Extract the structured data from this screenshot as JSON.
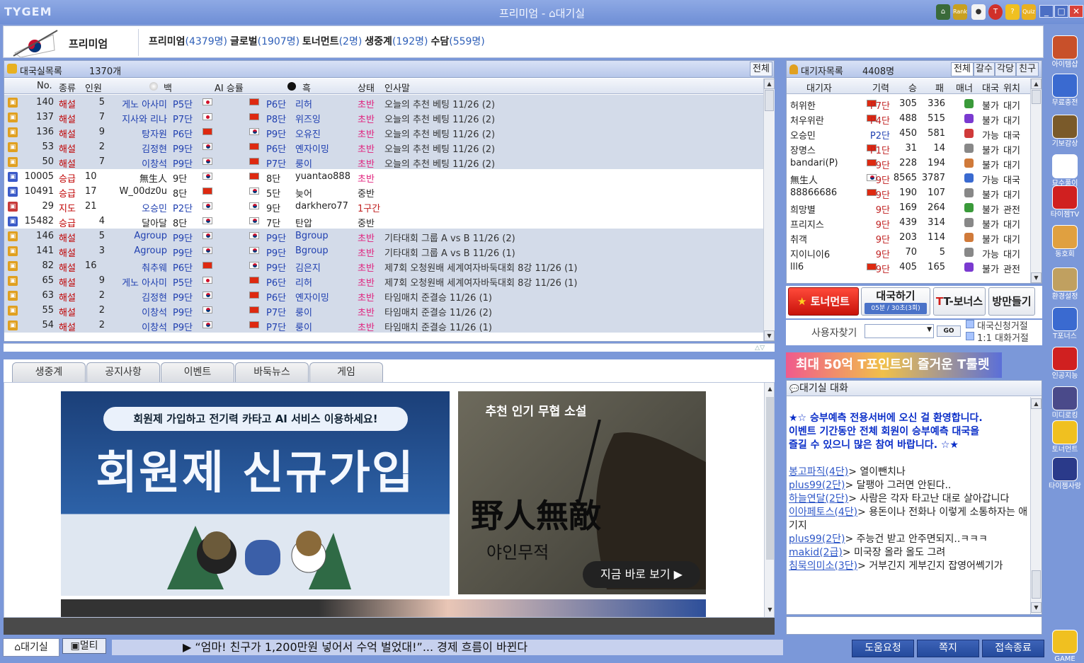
{
  "app": {
    "logo": "TYGEM",
    "title": "프리미엄 - ",
    "title_room": "대기실",
    "title_icons": [
      "Rank",
      "Quiz"
    ]
  },
  "header": {
    "label": "프리미엄",
    "servers": [
      {
        "name": "프리미엄",
        "count": "(4379명)"
      },
      {
        "name": "글로벌",
        "count": "(1907명)"
      },
      {
        "name": "토너먼트",
        "count": "(2명)"
      },
      {
        "name": "생중계",
        "count": "(192명)"
      },
      {
        "name": "수담",
        "count": "(559명)"
      }
    ]
  },
  "gamelist": {
    "title": "대국실목록",
    "count": "1370개",
    "all_button": "전체",
    "columns": [
      "No.",
      "종류",
      "인원",
      "백",
      "AI 승률",
      "흑",
      "상태",
      "인사말"
    ],
    "rows": [
      {
        "type": "B",
        "no": "140",
        "kind": "해설",
        "people": "5",
        "white": "게노 아사미",
        "wrank": "P5단",
        "wflag": "jp",
        "brank": "P6단",
        "black": "리허",
        "bflag": "cn",
        "status": "초반",
        "msg": "오늘의 추천 베팅 11/26 (2)",
        "hl": true
      },
      {
        "type": "B",
        "no": "137",
        "kind": "해설",
        "people": "7",
        "white": "지사와 리나",
        "wrank": "P7단",
        "wflag": "jp",
        "brank": "P8단",
        "black": "위즈잉",
        "bflag": "cn",
        "status": "초반",
        "msg": "오늘의 추천 베팅 11/26 (2)",
        "hl": true
      },
      {
        "type": "B",
        "no": "136",
        "kind": "해설",
        "people": "9",
        "white": "탕자원",
        "wrank": "P6단",
        "wflag": "cn",
        "brank": "P9단",
        "black": "오유진",
        "bflag": "kr",
        "status": "초반",
        "msg": "오늘의 추천 베팅 11/26 (2)",
        "hl": true
      },
      {
        "type": "B",
        "no": "53",
        "kind": "해설",
        "people": "2",
        "white": "김정현",
        "wrank": "P9단",
        "wflag": "kr",
        "brank": "P6단",
        "black": "옌자이밍",
        "bflag": "cn",
        "status": "초반",
        "msg": "오늘의 추천 베팅 11/26 (2)",
        "hl": true
      },
      {
        "type": "B",
        "no": "50",
        "kind": "해설",
        "people": "7",
        "white": "이창석",
        "wrank": "P9단",
        "wflag": "kr",
        "brank": "P7단",
        "black": "룽이",
        "bflag": "cn",
        "status": "초반",
        "msg": "오늘의 추천 베팅 11/26 (2)",
        "hl": true
      },
      {
        "type": "S",
        "no": "10005",
        "kind": "승급",
        "people": "10",
        "white": "無生人",
        "wrank": "9단",
        "wflag": "kr",
        "brank": "8단",
        "black": "yuantao888",
        "bflag": "cn",
        "status": "초반",
        "msg": "",
        "hl": false
      },
      {
        "type": "S",
        "no": "10491",
        "kind": "승급",
        "people": "17",
        "white": "W_00dz0u",
        "wrank": "8단",
        "wflag": "cn",
        "brank": "5단",
        "black": "늦어",
        "bflag": "kr",
        "status": "중반",
        "msg": "",
        "hl": false
      },
      {
        "type": "G",
        "no": "29",
        "kind": "지도",
        "people": "21",
        "white": "오승민",
        "wrank": "P2단",
        "wflag": "kr",
        "brank": "9단",
        "black": "darkhero77",
        "bflag": "kr",
        "status": "1구간",
        "msg": "",
        "hl": false
      },
      {
        "type": "S",
        "no": "15482",
        "kind": "승급",
        "people": "4",
        "white": "달아달",
        "wrank": "8단",
        "wflag": "kr",
        "brank": "7단",
        "black": "탄압",
        "bflag": "kr",
        "status": "중반",
        "msg": "",
        "hl": false
      },
      {
        "type": "B",
        "no": "146",
        "kind": "해설",
        "people": "5",
        "white": "Agroup",
        "wrank": "P9단",
        "wflag": "kr",
        "brank": "P9단",
        "black": "Bgroup",
        "bflag": "kr",
        "status": "초반",
        "msg": "기타대회 그룹 A vs B 11/26 (2)",
        "hl": true
      },
      {
        "type": "B",
        "no": "141",
        "kind": "해설",
        "people": "3",
        "white": "Agroup",
        "wrank": "P9단",
        "wflag": "kr",
        "brank": "P9단",
        "black": "Bgroup",
        "bflag": "kr",
        "status": "초반",
        "msg": "기타대회 그룹 A vs B 11/26 (1)",
        "hl": true
      },
      {
        "type": "B",
        "no": "82",
        "kind": "해설",
        "people": "16",
        "white": "춰추웨",
        "wrank": "P6단",
        "wflag": "cn",
        "brank": "P9단",
        "black": "김은지",
        "bflag": "kr",
        "status": "초반",
        "msg": "제7회 오청원배 세계여자바둑대회 8강 11/26 (1)",
        "hl": true
      },
      {
        "type": "B",
        "no": "65",
        "kind": "해설",
        "people": "9",
        "white": "게노 아사미",
        "wrank": "P5단",
        "wflag": "jp",
        "brank": "P6단",
        "black": "리허",
        "bflag": "cn",
        "status": "초반",
        "msg": "제7회 오청원배 세계여자바둑대회 8강 11/26 (1)",
        "hl": true
      },
      {
        "type": "B",
        "no": "63",
        "kind": "해설",
        "people": "2",
        "white": "김정현",
        "wrank": "P9단",
        "wflag": "kr",
        "brank": "P6단",
        "black": "옌자이밍",
        "bflag": "cn",
        "status": "초반",
        "msg": "타임매치 준결승 11/26 (1)",
        "hl": true
      },
      {
        "type": "B",
        "no": "55",
        "kind": "해설",
        "people": "2",
        "white": "이창석",
        "wrank": "P9단",
        "wflag": "kr",
        "brank": "P7단",
        "black": "룽이",
        "bflag": "cn",
        "status": "초반",
        "msg": "타임매치 준결승 11/26 (2)",
        "hl": true
      },
      {
        "type": "B",
        "no": "54",
        "kind": "해설",
        "people": "2",
        "white": "이창석",
        "wrank": "P9단",
        "wflag": "kr",
        "brank": "P7단",
        "black": "룽이",
        "bflag": "cn",
        "status": "초반",
        "msg": "타임매치 준결승 11/26 (1)",
        "hl": true
      }
    ]
  },
  "tabs": [
    "생중계",
    "공지사항",
    "이벤트",
    "바둑뉴스",
    "게임"
  ],
  "banners": {
    "b1_top": "회원제 가입하고 전기력 카타고 AI 서비스 이용하세요!",
    "b1_big": "회원제 신규가입",
    "b2_title": "추천 인기 무협 소설",
    "b2_hanja": "野人無敵",
    "b2_korean": "야인무적",
    "b2_button": "지금 바로 보기 ▶"
  },
  "bottom": {
    "tab_waiting": "대기실",
    "tab_multi": "멀티",
    "ticker": "▶ “엄마! 친구가 1,200만원 넣어서 수억 벌었대!”... 경제 흐름이 바뀐다",
    "buttons": [
      "도움요청",
      "쪽지",
      "접속종료"
    ]
  },
  "userlist": {
    "title": "대기자목록",
    "count": "4408명",
    "tabs": [
      "전체",
      "갈수",
      "각당",
      "친구"
    ],
    "columns": [
      "대기자",
      "기력",
      "승",
      "패",
      "매너",
      "대국",
      "위치"
    ],
    "rows": [
      {
        "name": "허위한",
        "flag": "cn",
        "rank": "P7단",
        "win": "305",
        "loss": "336",
        "manner": "#3a9a3a",
        "game": "불가",
        "loc": "대기",
        "rank_red": true
      },
      {
        "name": "처우위란",
        "flag": "cn",
        "rank": "P4단",
        "win": "488",
        "loss": "515",
        "manner": "#7a3ad0",
        "game": "불가",
        "loc": "대기",
        "rank_red": true
      },
      {
        "name": "오승민",
        "flag": "",
        "rank": "P2단",
        "win": "450",
        "loss": "581",
        "manner": "#d03a3a",
        "game": "가능",
        "loc": "대국",
        "rank_red": false
      },
      {
        "name": "장명스",
        "flag": "cn",
        "rank": "P1단",
        "win": "31",
        "loss": "14",
        "manner": "#888",
        "game": "불가",
        "loc": "대기",
        "rank_red": true
      },
      {
        "name": "bandari(P)",
        "flag": "cn",
        "rank": "9단",
        "win": "228",
        "loss": "194",
        "manner": "#d07a3a",
        "game": "불가",
        "loc": "대기",
        "rank_red": true
      },
      {
        "name": "無生人",
        "flag": "kr",
        "rank": "9단",
        "win": "8565",
        "loss": "3787",
        "manner": "#3a6ad0",
        "game": "가능",
        "loc": "대국",
        "rank_red": true
      },
      {
        "name": "88866686",
        "flag": "cn",
        "rank": "9단",
        "win": "190",
        "loss": "107",
        "manner": "#888",
        "game": "불가",
        "loc": "대기",
        "rank_red": true
      },
      {
        "name": "희망별",
        "flag": "",
        "rank": "9단",
        "win": "169",
        "loss": "264",
        "manner": "#3a9a3a",
        "game": "불가",
        "loc": "관전",
        "rank_red": true
      },
      {
        "name": "프리지스",
        "flag": "",
        "rank": "9단",
        "win": "439",
        "loss": "314",
        "manner": "#888",
        "game": "불가",
        "loc": "대기",
        "rank_red": true
      },
      {
        "name": "취객",
        "flag": "",
        "rank": "9단",
        "win": "203",
        "loss": "114",
        "manner": "#d07a3a",
        "game": "불가",
        "loc": "대기",
        "rank_red": true
      },
      {
        "name": "지이니이6",
        "flag": "",
        "rank": "9단",
        "win": "70",
        "loss": "5",
        "manner": "#888",
        "game": "가능",
        "loc": "대기",
        "rank_red": true
      },
      {
        "name": "lll6",
        "flag": "cn",
        "rank": "9단",
        "win": "405",
        "loss": "165",
        "manner": "#7a3ad0",
        "game": "불가",
        "loc": "관전",
        "rank_red": true
      }
    ]
  },
  "actions": {
    "tournament": "토너먼트",
    "play": "대국하기",
    "play_sub": "05분 / 30초(3회)",
    "bonus": "T-보너스",
    "make_room": "방만들기",
    "search_label": "사용자찾기",
    "go": "GO",
    "opt1": "대국신청거절",
    "opt2": "1:1 대화거절"
  },
  "ad": "최대 50억 T포인트의 즐거운 T룰렛",
  "chat": {
    "title": "대기실 대화",
    "notice": [
      "★☆ 승부예측 전용서버에 오신 걸 환영합니다.",
      "이벤트 기간동안 전체 회원이 승부예측 대국을",
      "즐길 수 있으니 많은 참여 바랍니다. ☆★"
    ],
    "lines": [
      {
        "user": "봉고파직(4단)",
        "msg": "> 열이뺀치나"
      },
      {
        "user": "plus99(2단)",
        "msg": "> 달팽아 그러면 안된다.."
      },
      {
        "user": "하늘연달(2단)",
        "msg": "> 사람은 각자 타고난 대로 살아갑니다"
      },
      {
        "user": "이아페토스(4단)",
        "msg": "> 용돈이나 전화나 이렇게 소통하자는 애기지"
      },
      {
        "user": "plus99(2단)",
        "msg": "> 주능건 받고 안주면되지..ㅋㅋㅋ"
      },
      {
        "user": "makid(2급)",
        "msg": "> 미국장 올라 올도 그려"
      },
      {
        "user": "침묵의미소(3단)",
        "msg": "> 거부긴지 게부긴지 잡영어쎅기가"
      }
    ]
  },
  "sidebar": [
    "아이템샵",
    "무료충전",
    "기보감상",
    "묘수풀이",
    "타이젬TV",
    "동호회",
    "환경설정",
    "T포너스",
    "인공지능",
    "미디로킹",
    "토너먼트",
    "타이젬사랑",
    "GAME"
  ],
  "colors": {
    "title": "#7b98d9",
    "highlight": "#d3dbe9",
    "link": "#2040b0",
    "status": "#e0207c"
  }
}
